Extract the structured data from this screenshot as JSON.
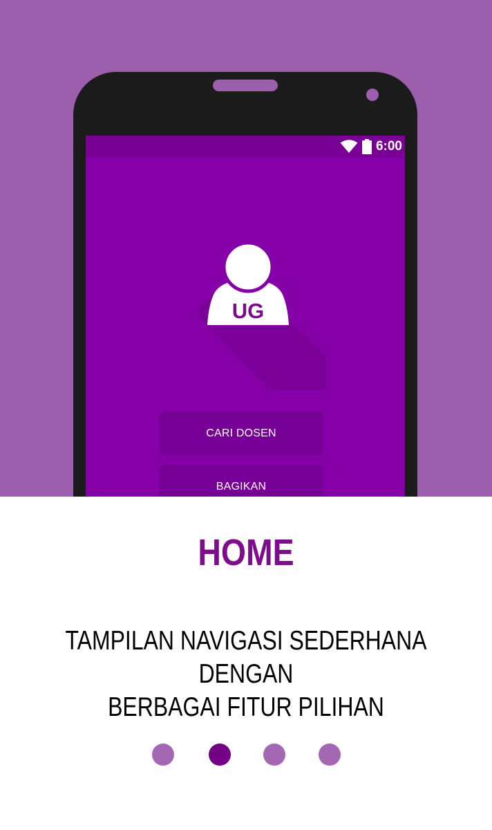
{
  "phone": {
    "status_bar": {
      "time": "6:00",
      "icons": [
        "wifi-icon",
        "battery-icon"
      ]
    },
    "logo": {
      "initials": "UG",
      "icon": "person-icon"
    },
    "menu": [
      {
        "label": "CARI DOSEN"
      },
      {
        "label": "BAGIKAN"
      }
    ]
  },
  "slide": {
    "title": "HOME",
    "description": "TAMPILAN NAVIGASI SEDERHANA DENGAN\nBERBAGAI FITUR PILIHAN"
  },
  "pager": {
    "count": 4,
    "active_index": 1
  },
  "colors": {
    "hero_bg": "#9c5fae",
    "screen_bg": "#8500a6",
    "accent": "#7d0d8a",
    "dot_inactive": "#a467b3",
    "dot_active": "#740086"
  }
}
